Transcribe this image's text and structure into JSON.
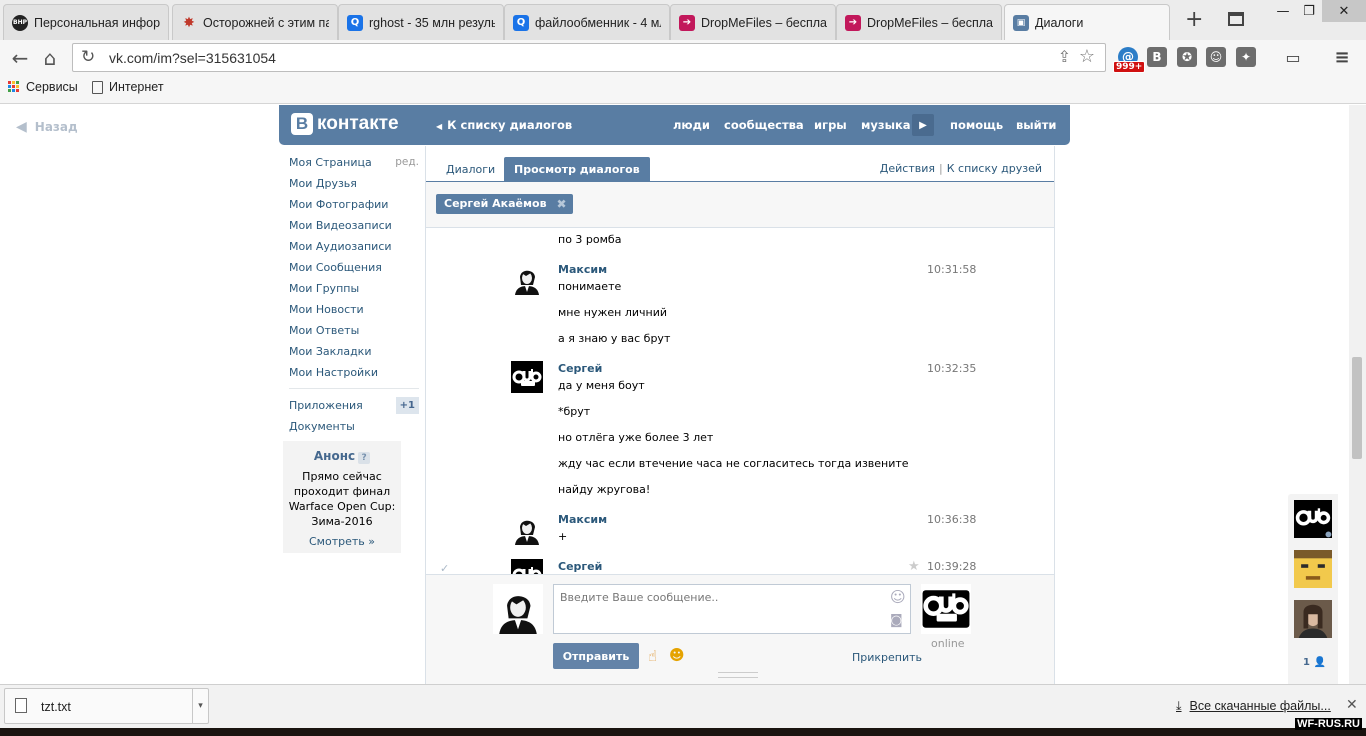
{
  "browser": {
    "tabs": [
      {
        "title": "Персональная информ",
        "favicon_text": "ВНР",
        "favicon_color": "#222222"
      },
      {
        "title": "Осторожней с этим па",
        "favicon_text": "✸",
        "favicon_color": "#c0392b"
      },
      {
        "title": "rghost - 35 млн резуль",
        "favicon_text": "Q",
        "favicon_color": "#1a73e8"
      },
      {
        "title": "файлообменник - 4 мл",
        "favicon_text": "Q",
        "favicon_color": "#1a73e8"
      },
      {
        "title": "DropMeFiles – бесплат",
        "favicon_text": "➔",
        "favicon_color": "#c2185b"
      },
      {
        "title": "DropMeFiles – бесплат",
        "favicon_text": "➔",
        "favicon_color": "#c2185b"
      },
      {
        "title": "Диалоги",
        "favicon_text": "▣",
        "favicon_color": "#597da3"
      }
    ],
    "url": "vk.com/im?sel=315631054",
    "ext_badge": "999+",
    "bookmarks": [
      {
        "label": "Сервисы"
      },
      {
        "label": "Интернет"
      }
    ],
    "download": {
      "file": "tzt.txt",
      "all_label": "Все скачанные файлы..."
    },
    "watermark": "WF-RUS.RU"
  },
  "page": {
    "back_label": "Назад"
  },
  "header": {
    "logo_letter": "В",
    "logo_text": "контакте",
    "back_to_dialogs": "К списку диалогов",
    "menu": [
      "люди",
      "сообщества",
      "игры",
      "музыка",
      "помощь",
      "выйти"
    ]
  },
  "left_nav": {
    "items": [
      "Моя Страница",
      "Мои Друзья",
      "Мои Фотографии",
      "Мои Видеозаписи",
      "Мои Аудиозаписи",
      "Мои Сообщения",
      "Мои Группы",
      "Мои Новости",
      "Мои Ответы",
      "Мои Закладки",
      "Мои Настройки"
    ],
    "edit_label": "ред.",
    "apps_label": "Приложения",
    "apps_badge": "+1",
    "docs_label": "Документы"
  },
  "anons": {
    "title": "Анонс",
    "help": "?",
    "text": [
      "Прямо сейчас",
      "проходит финал",
      "Warface Open Cup:",
      "Зима-2016"
    ],
    "more": "Смотреть »"
  },
  "dialog": {
    "tabs": [
      "Диалоги",
      "Просмотр диалогов"
    ],
    "actions": "Действия",
    "friends_list": "К списку друзей",
    "chip": "Сергей Акаёмов",
    "groups": [
      {
        "author": "",
        "time": "",
        "lines": [
          "по 3 ромба"
        ]
      },
      {
        "author": "Максим",
        "time": "10:31:58",
        "lines": [
          "понимаете",
          "мне нужен личний",
          "а я знаю у вас брут"
        ]
      },
      {
        "author": "Сергей",
        "time": "10:32:35",
        "lines": [
          "да у меня боут",
          "*брут",
          "но отлёга уже более 3 лет",
          "жду час если втечение часа не согласитесь тогда извените",
          "найду жругова!"
        ]
      },
      {
        "author": "Максим",
        "time": "10:36:38",
        "lines": [
          "+"
        ]
      },
      {
        "author": "Сергей",
        "time": "10:39:28",
        "lines": []
      }
    ],
    "compose": {
      "placeholder": "Введите Ваше сообщение..",
      "send": "Отправить",
      "attach": "Прикрепить",
      "status": "online"
    }
  },
  "side_friends": {
    "count": "1"
  }
}
